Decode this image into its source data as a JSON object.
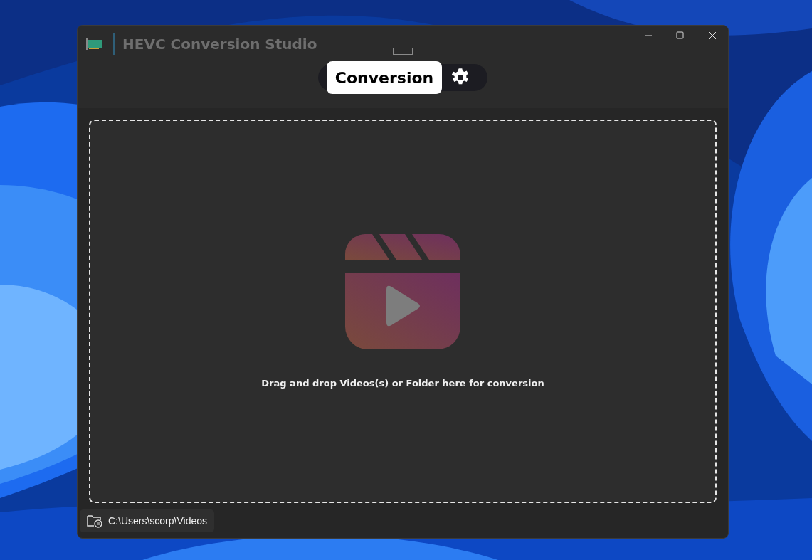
{
  "window": {
    "title": "HEVC Conversion Studio"
  },
  "tabs": [
    {
      "kind": "text",
      "label": "Conversion",
      "selected": true
    },
    {
      "kind": "icon",
      "selected": false
    }
  ],
  "drop_zone": {
    "message": "Drag and drop Videos(s) or Folder here for conversion"
  },
  "output_folder": {
    "path": "C:\\Users\\scorp\\Videos"
  }
}
